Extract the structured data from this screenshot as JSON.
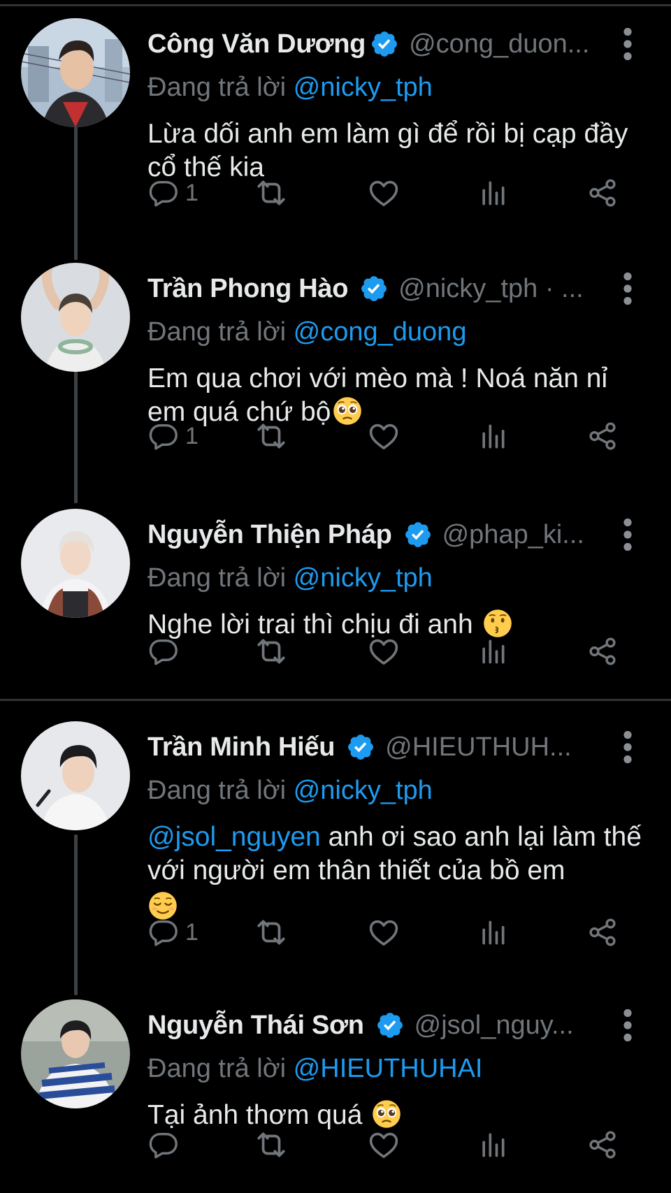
{
  "colors": {
    "background": "#000000",
    "name": "#e7e9ea",
    "secondary": "#71767b",
    "mention": "#1d9bf0",
    "verified": "#1d9bf0",
    "divider": "#2f3336"
  },
  "reply_prefix": "Đang trả lời",
  "tweets": [
    {
      "name": "Công Văn Dương",
      "handle": "@cong_duon...",
      "reply_to": "@nicky_tph",
      "text": "Lừa dối anh em làm gì để rồi bị cạp đầy cổ thế kia",
      "emoji": "",
      "reply_count": "1"
    },
    {
      "name": "Trần Phong Hào",
      "handle": "@nicky_tph · ...",
      "reply_to": "@cong_duong",
      "text": "Em qua chơi với mèo mà ! Noá năn nỉ em quá chứ bộ",
      "emoji": "pleading-face",
      "reply_count": "1"
    },
    {
      "name": "Nguyễn Thiện Pháp",
      "handle": "@phap_ki...",
      "reply_to": "@nicky_tph",
      "text": "Nghe lời trai thì chịu đi anh ",
      "emoji": "kissing-face",
      "reply_count": ""
    },
    {
      "name": "Trần Minh Hiếu",
      "handle": "@HIEUTHUH...",
      "reply_to": "@nicky_tph",
      "text_mention": "@jsol_nguyen",
      "text": " anh ơi sao anh lại làm thế với người em thân thiết của bồ em",
      "emoji": "relieved-face",
      "reply_count": "1"
    },
    {
      "name": "Nguyễn Thái Sơn",
      "handle": "@jsol_nguy...",
      "reply_to": "@HIEUTHUHAI",
      "text": "Tại ảnh thơm quá ",
      "emoji": "pleading-face",
      "reply_count": ""
    }
  ]
}
